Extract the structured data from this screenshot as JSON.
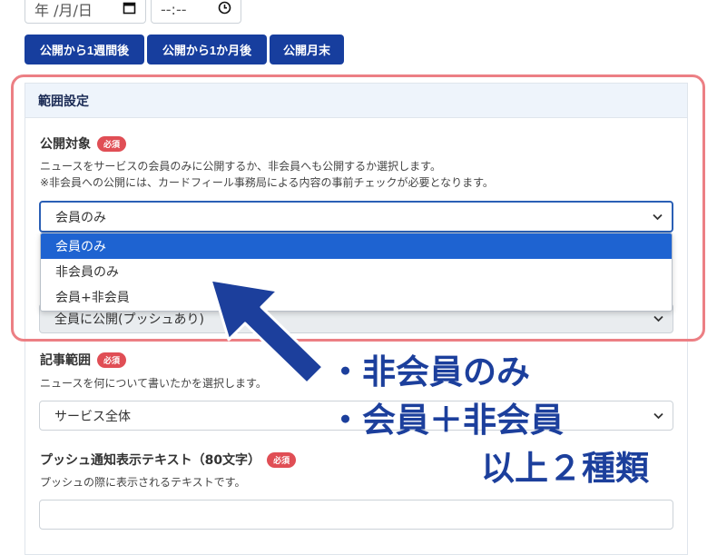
{
  "date_input": {
    "placeholder": "年 /月/日",
    "icon": "calendar-icon"
  },
  "time_input": {
    "placeholder": "--:--",
    "icon": "clock-icon"
  },
  "quick_buttons": [
    "公開から1週間後",
    "公開から1か月後",
    "公開月末"
  ],
  "range_section": {
    "header": "範囲設定",
    "target": {
      "label": "公開対象",
      "required_badge": "必須",
      "help_line1": "ニュースをサービスの会員のみに公開するか、非会員へも公開するか選択します。",
      "help_line2": "※非会員への公開には、カードフィール事務局による内容の事前チェックが必要となります。",
      "selected": "会員のみ",
      "options": [
        "会員のみ",
        "非会員のみ",
        "会員+非会員"
      ]
    },
    "hidden_select_value": "全員に公開(プッシュあり)"
  },
  "article_scope": {
    "label": "記事範囲",
    "required_badge": "必須",
    "help": "ニュースを何について書いたかを選択します。",
    "selected": "サービス全体"
  },
  "push_text": {
    "label": "プッシュ通知表示テキスト（80文字）",
    "required_badge": "必須",
    "help": "プッシュの際に表示されるテキストです。",
    "value": ""
  },
  "annotation": {
    "line1": "・非会員のみ",
    "line2": "・会員＋非会員",
    "line3": "以上２種類",
    "color": "#1c3f9c",
    "frame_color": "#ec7f84"
  }
}
